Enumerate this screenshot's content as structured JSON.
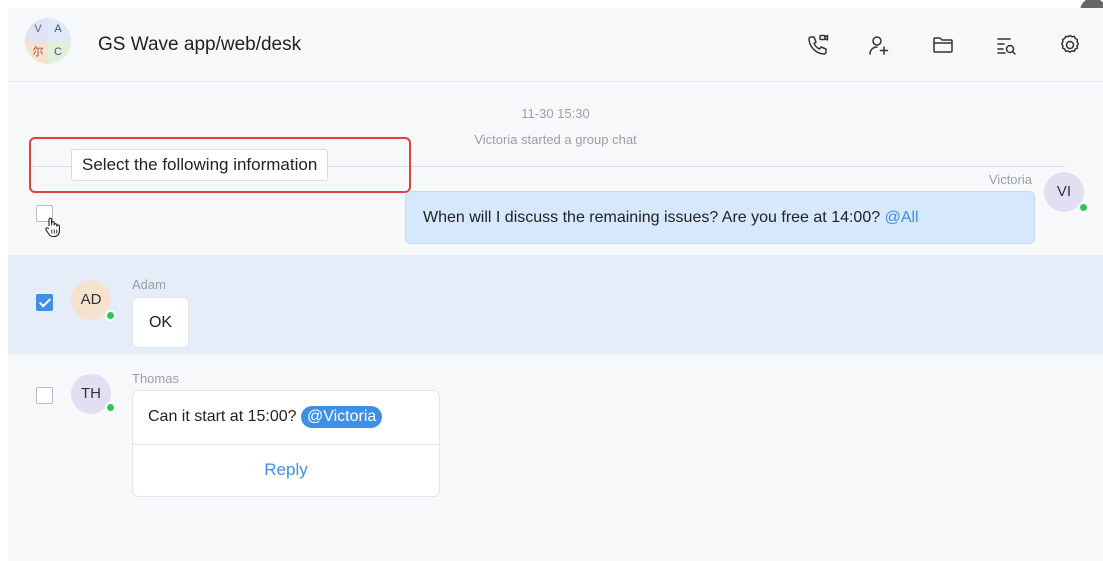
{
  "header": {
    "title": "GS Wave app/web/desk",
    "group_avatar": {
      "q1": "V",
      "q2": "A",
      "q3": "尔",
      "q4": "C"
    },
    "icons": [
      "call-icon",
      "add-member-icon",
      "folder-icon",
      "search-history-icon",
      "settings-icon"
    ]
  },
  "system": {
    "time": "11-30 15:30",
    "text": "Victoria started a group chat"
  },
  "selection_tip": "Select the following information",
  "messages": [
    {
      "sender": "Victoria",
      "avatar": "VI",
      "text": "When will I discuss the remaining issues? Are you free at 14:00?",
      "mention": "@All",
      "selected": false
    },
    {
      "sender": "Adam",
      "avatar": "AD",
      "text": "OK",
      "selected": true
    },
    {
      "sender": "Thomas",
      "avatar": "TH",
      "text": "Can it start at 15:00?",
      "mention": "@Victoria",
      "reply_label": "Reply",
      "selected": false
    }
  ],
  "colors": {
    "accent": "#3f8fe6",
    "online": "#2fc653",
    "highlight_box": "#d9453a",
    "selected_row": "#e4edf8",
    "bubble_blue": "#d6e8fb"
  }
}
